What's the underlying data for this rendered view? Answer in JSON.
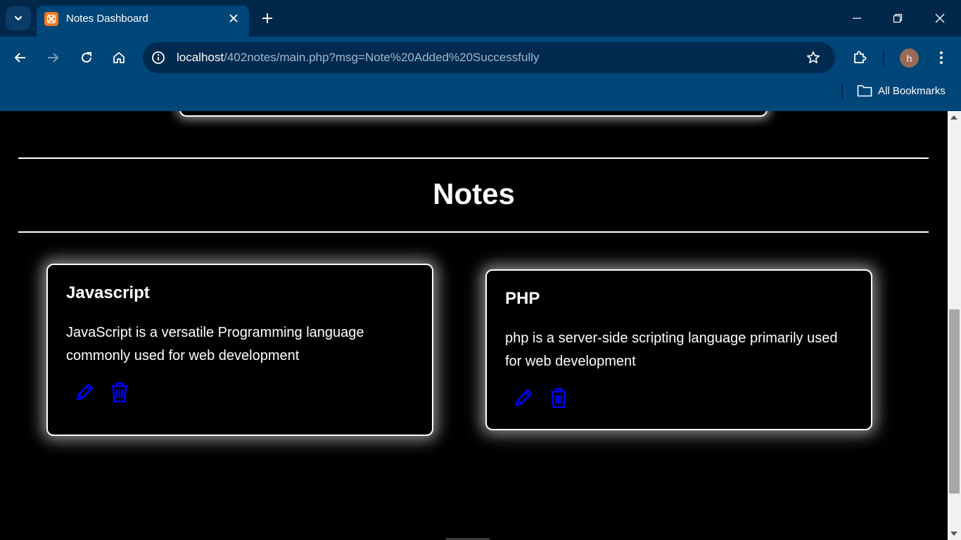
{
  "browser": {
    "tab_title": "Notes Dashboard",
    "url_host": "localhost",
    "url_path": "/402notes/main.php?msg=Note%20Added%20Successfully",
    "profile_initial": "h",
    "bookmarks_label": "All Bookmarks",
    "icons": [
      "tab-list-icon",
      "xampp-favicon-icon",
      "close-icon",
      "plus-icon",
      "minimize-icon",
      "restore-icon",
      "window-close-icon",
      "back-icon",
      "forward-icon",
      "reload-icon",
      "home-icon",
      "site-info-icon",
      "star-icon",
      "extensions-icon",
      "kebab-menu-icon",
      "folder-icon"
    ]
  },
  "main": {
    "section_title": "Notes",
    "notes": [
      {
        "title": "Javascript",
        "body": "JavaScript is a versatile Programming language commonly used for web development",
        "actions": [
          "edit-icon",
          "delete-icon"
        ]
      },
      {
        "title": "PHP",
        "body": "php is a server-side scripting language primarily used for web development",
        "actions": [
          "edit-icon",
          "delete-icon"
        ]
      }
    ]
  },
  "colors": {
    "tabbar_bg": "#022849",
    "toolbar_bg": "#004679",
    "page_bg": "#000000",
    "action_icon": "#0000ff",
    "text": "#ffffff"
  }
}
